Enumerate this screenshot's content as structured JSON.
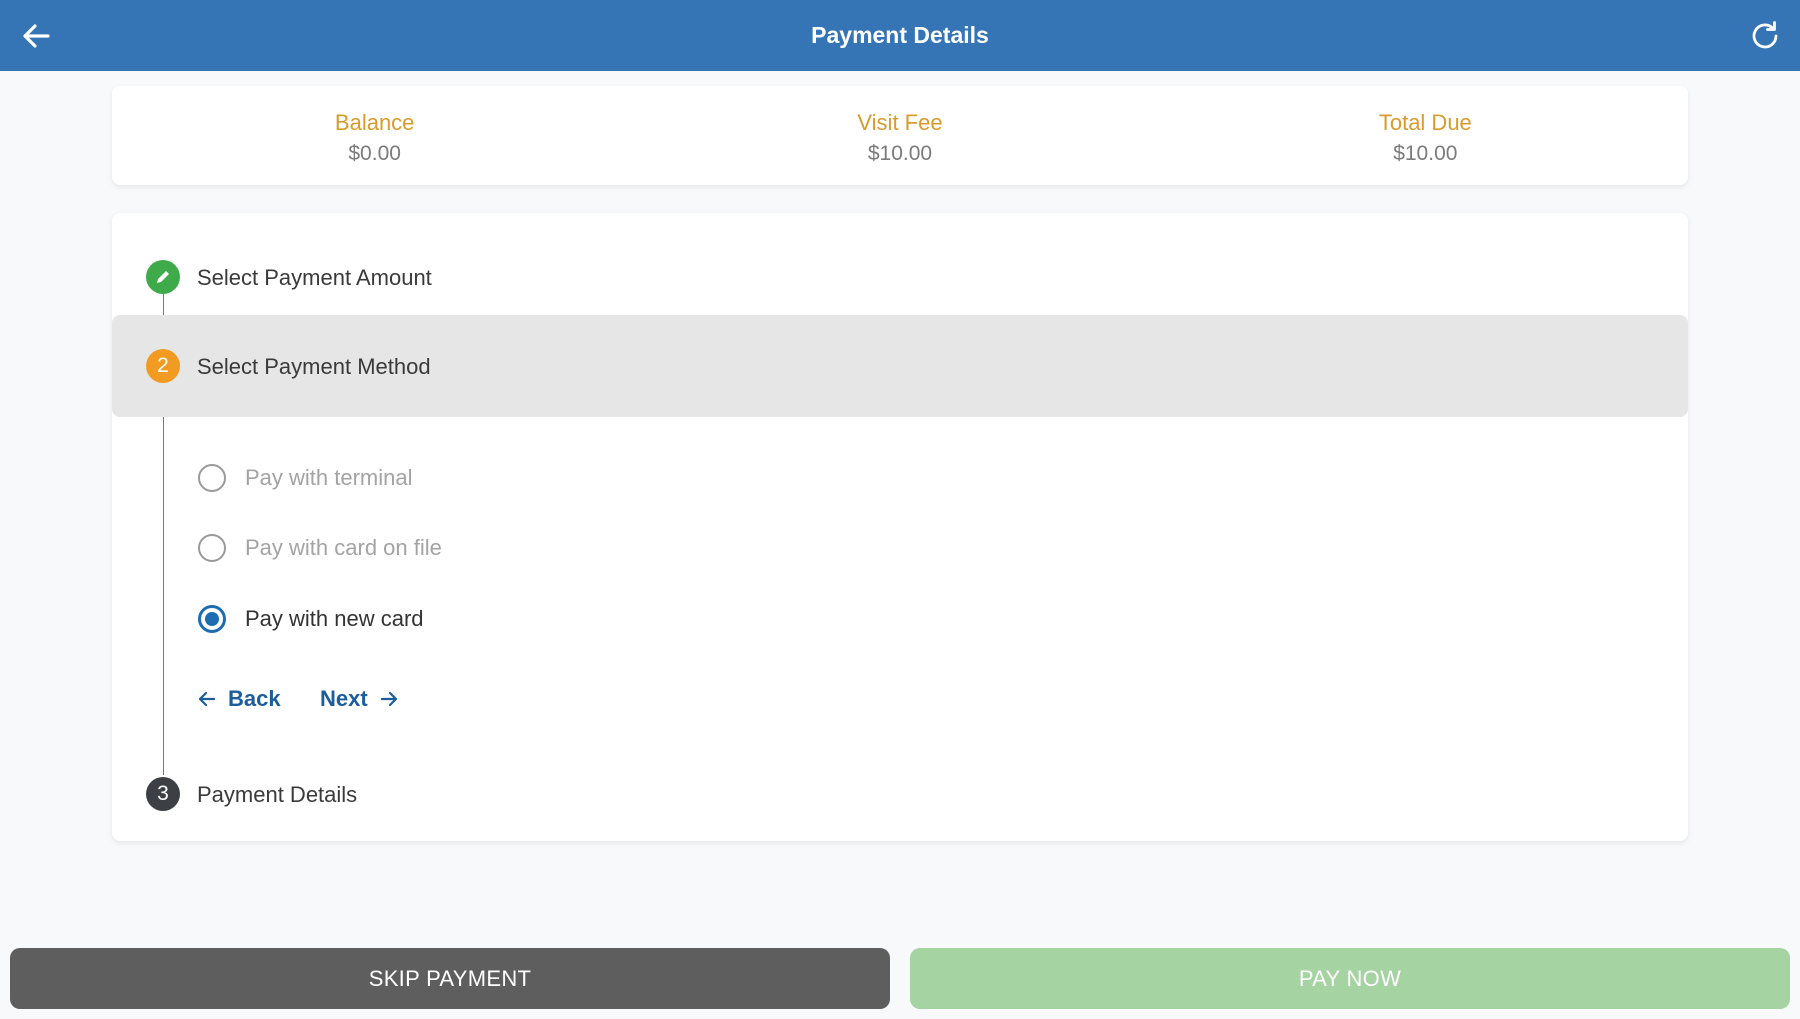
{
  "header": {
    "title": "Payment Details",
    "back_icon": "arrow-left-icon",
    "refresh_icon": "refresh-icon",
    "background_color": "#3575b6"
  },
  "summary": {
    "balance_label": "Balance",
    "balance_value": "$0.00",
    "visit_fee_label": "Visit Fee",
    "visit_fee_value": "$10.00",
    "total_due_label": "Total Due",
    "total_due_value": "$10.00",
    "label_color": "#d99b2b"
  },
  "steps": [
    {
      "number": "",
      "label": "Select Payment Amount",
      "status": "complete",
      "icon": "pencil-icon"
    },
    {
      "number": "2",
      "label": "Select Payment Method",
      "status": "active"
    },
    {
      "number": "3",
      "label": "Payment Details",
      "status": "pending"
    }
  ],
  "payment_methods": {
    "options": [
      {
        "label": "Pay with terminal",
        "selected": false
      },
      {
        "label": "Pay with card on file",
        "selected": false
      },
      {
        "label": "Pay with new card",
        "selected": true
      }
    ],
    "back_label": "Back",
    "next_label": "Next"
  },
  "footer": {
    "skip_label": "SKIP PAYMENT",
    "pay_label": "PAY NOW",
    "skip_color": "#5e5e5e",
    "pay_color": "#a5d3a1"
  }
}
